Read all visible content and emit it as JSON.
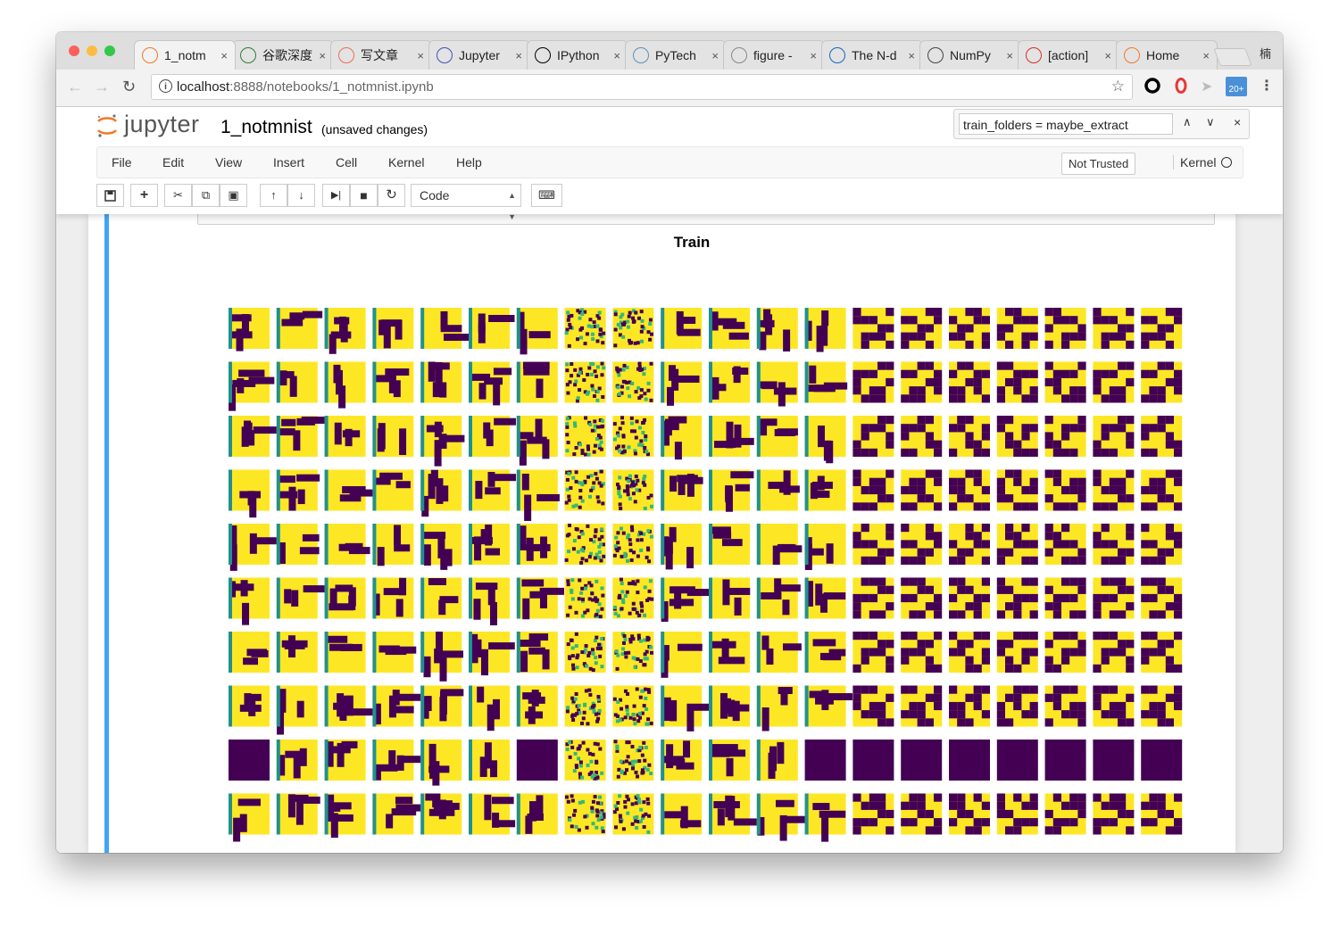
{
  "browser": {
    "tabs": [
      {
        "label": "1_notm",
        "icon": "jupyter-icon",
        "color": "#f37726",
        "active": true
      },
      {
        "label": "谷歌深度",
        "icon": "bird-icon",
        "color": "#2e7d32"
      },
      {
        "label": "写文章",
        "icon": "jian-icon",
        "color": "#ea6f5a"
      },
      {
        "label": "Jupyter",
        "icon": "jupyter-blue-icon",
        "color": "#3f51b5"
      },
      {
        "label": "IPython",
        "icon": "x-icon",
        "color": "#000000"
      },
      {
        "label": "PyTech",
        "icon": "cloud-icon",
        "color": "#5c8fb8"
      },
      {
        "label": "figure -",
        "icon": "flower-icon",
        "color": "#888888"
      },
      {
        "label": "The N-d",
        "icon": "s-icon",
        "color": "#1565c0"
      },
      {
        "label": "NumPy",
        "icon": "book-icon",
        "color": "#444444"
      },
      {
        "label": "[action]",
        "icon": "c-icon",
        "color": "#d32f2f"
      },
      {
        "label": "Home",
        "icon": "jupyter-home-icon",
        "color": "#f37726"
      }
    ],
    "tab_close": "×",
    "profile": "楠",
    "url_host": "localhost",
    "url_path": ":8888/notebooks/1_notmnist.ipynb",
    "ext_badge": "20+"
  },
  "jupyter": {
    "logo_text": "jupyter",
    "notebook_name": "1_notmnist",
    "status": "(unsaved changes)",
    "find_text": "train_folders = maybe_extract",
    "menus": [
      "File",
      "Edit",
      "View",
      "Insert",
      "Cell",
      "Kernel",
      "Help"
    ],
    "not_trusted": "Not Trusted",
    "kernel_label": "Kernel",
    "cell_type": "Code"
  },
  "figure": {
    "title": "Train",
    "colors": {
      "purple": "#440154",
      "yellow": "#fde725",
      "green": "#35b779",
      "teal": "#21918c"
    }
  }
}
